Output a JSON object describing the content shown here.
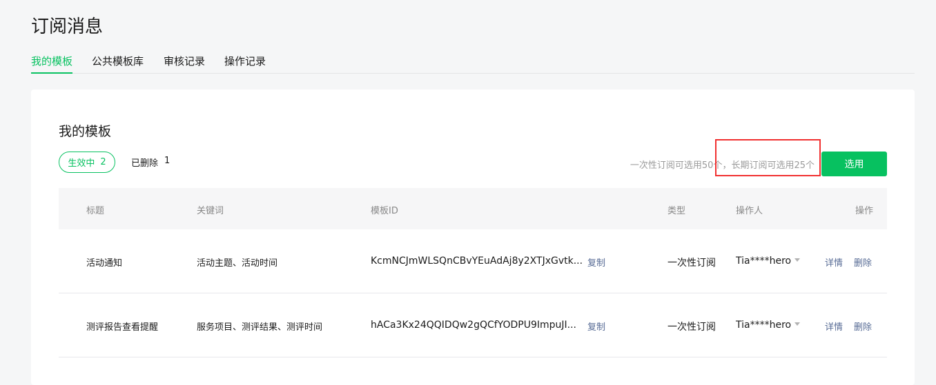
{
  "page": {
    "title": "订阅消息"
  },
  "tabs": [
    {
      "label": "我的模板",
      "active": true
    },
    {
      "label": "公共模板库",
      "active": false
    },
    {
      "label": "审核记录",
      "active": false
    },
    {
      "label": "操作记录",
      "active": false
    }
  ],
  "section": {
    "title": "我的模板",
    "filters": {
      "active_label": "生效中",
      "active_count": "2",
      "deleted_label": "已删除",
      "deleted_count": "1"
    },
    "quota_note": "一次性订阅可选用50个，长期订阅可选用25个",
    "select_button": "选用"
  },
  "table": {
    "headers": {
      "title": "标题",
      "keywords": "关键词",
      "template_id": "模板ID",
      "type": "类型",
      "operator": "操作人",
      "actions": "操作"
    },
    "rows": [
      {
        "title": "活动通知",
        "keywords": "活动主题、活动时间",
        "template_id": "KcmNCJmWLSQnCBvYEuAdAj8y2XTJxGvtk...",
        "copy": "复制",
        "type": "一次性订阅",
        "operator": "Tia****hero",
        "detail": "详情",
        "delete": "删除"
      },
      {
        "title": "测评报告查看提醒",
        "keywords": "服务项目、测评结果、测评时间",
        "template_id": "hACa3Kx24QQIDQw2gQCfYODPU9ImpuJI...",
        "copy": "复制",
        "type": "一次性订阅",
        "operator": "Tia****hero",
        "detail": "详情",
        "delete": "删除"
      }
    ]
  },
  "colors": {
    "accent": "#07c160",
    "link": "#576b95",
    "highlight": "#f12f2f"
  }
}
